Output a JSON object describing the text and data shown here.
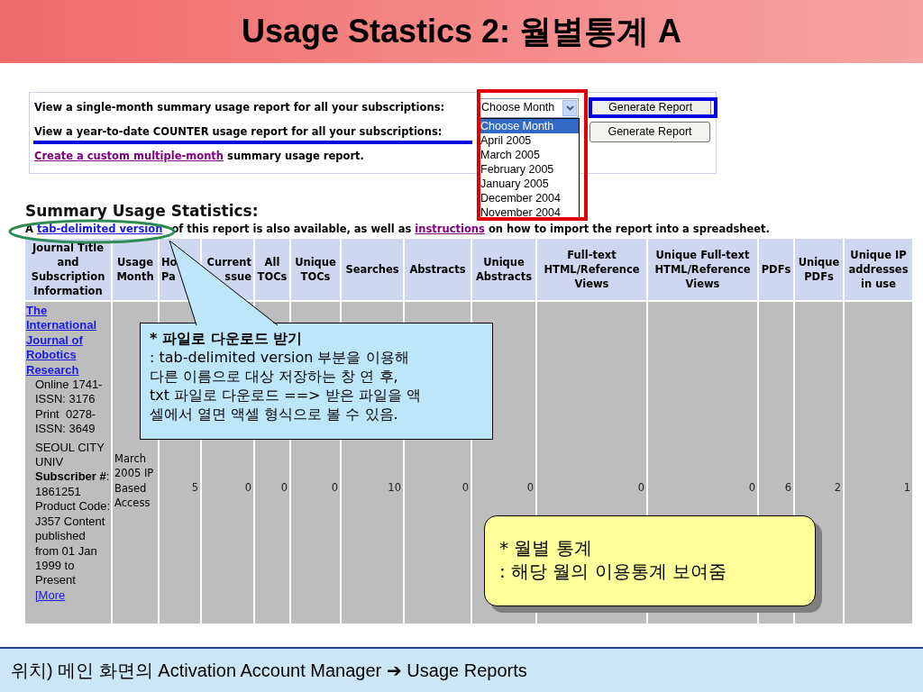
{
  "slide_title": "Usage Stastics 2: 월별통계 A",
  "report_panel": {
    "single_month": {
      "label": "View a single-month summary usage report for all your subscriptions:",
      "month_select": {
        "value": "Choose Month",
        "expanded": true,
        "options": [
          {
            "label": "Choose Month",
            "selected": true
          },
          {
            "label": "April 2005",
            "selected": false
          },
          {
            "label": "March 2005",
            "selected": false
          },
          {
            "label": "February 2005",
            "selected": false
          },
          {
            "label": "January 2005",
            "selected": false
          },
          {
            "label": "December 2004",
            "selected": false
          },
          {
            "label": "November 2004",
            "selected": false
          }
        ]
      },
      "button": "Generate Report"
    },
    "year_to_date": {
      "label": "View a year-to-date COUNTER usage report for all your subscriptions:",
      "button": "Generate Report"
    },
    "custom": {
      "link": "Create a custom multiple-month",
      "text": " summary usage report."
    }
  },
  "summary": {
    "heading": "Summary Usage Statistics:",
    "note": [
      {
        "kind": "text",
        "text": "A "
      },
      {
        "kind": "link",
        "text": "tab-delimited version",
        "visited": false
      },
      {
        "kind": "text",
        "text": " of this report is also available, as well as "
      },
      {
        "kind": "link",
        "text": "instructions",
        "visited": true
      },
      {
        "kind": "text",
        "text": " on how to import the report into a spreadsheet."
      }
    ]
  },
  "table": {
    "columns": [
      [
        "Journal Title",
        "and",
        "Subscription",
        "Information"
      ],
      [
        "Usage",
        "Month"
      ],
      [
        "Ho",
        "Pa"
      ],
      [
        "Current",
        "ssue"
      ],
      [
        "All",
        "TOCs"
      ],
      [
        "Unique",
        "TOCs"
      ],
      [
        "Searches"
      ],
      [
        "Abstracts"
      ],
      [
        "Unique",
        "Abstracts"
      ],
      [
        "Full-text",
        "HTML/Reference",
        "Views"
      ],
      [
        "Unique Full-text",
        "HTML/Reference",
        "Views"
      ],
      [
        "PDFs"
      ],
      [
        "Unique",
        "PDFs"
      ],
      [
        "Unique IP",
        "addresses",
        "in use"
      ]
    ],
    "rows": [
      {
        "journal": {
          "title": "The International Journal of Robotics Research",
          "issn_lines": [
            "Online 1741-",
            "ISSN: 3176",
            "Print  0278-",
            "ISSN: 3649"
          ],
          "details": "SEOUL CITY UNIV **Subscriber #**: 1861251 Product Code: J357 Content published from 01 Jan 1999 to Present",
          "more_link": "[More"
        },
        "usage_month": "March 2005 IP Based Access",
        "values": [
          "5",
          "0",
          "0",
          "0",
          "10",
          "0",
          "0",
          "0",
          "0",
          "6",
          "2",
          "1"
        ]
      }
    ]
  },
  "callouts": [
    {
      "kind": "boxed",
      "title": "* 파일로 다운로드 받기",
      "lines": [
        ": tab-delimited version 부분을 이용해",
        "다른 이름으로 대상 저장하는 창 연 후,",
        "txt 파일로 다운로드 ==> 받은 파일을 액",
        "셀에서 열면 액셀 형식으로 볼 수 있음."
      ]
    },
    {
      "kind": "rounded",
      "lines": [
        "* 월별 통계",
        ": 해당 월의 이용통계 보여줌"
      ]
    }
  ],
  "footer": "위치) 메인 화면의 Activation Account Manager ➔ Usage Reports"
}
